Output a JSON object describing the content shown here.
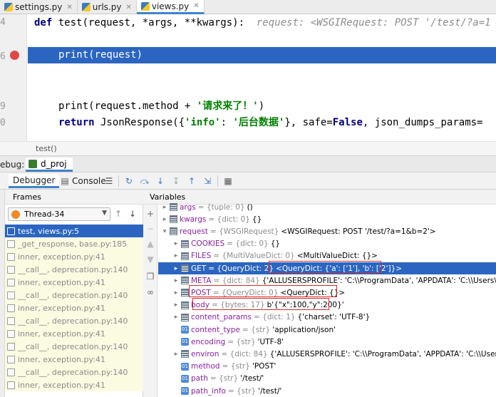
{
  "tabs": [
    {
      "label": "settings.py",
      "active": false
    },
    {
      "label": "urls.py",
      "active": false
    },
    {
      "label": "views.py",
      "active": true
    }
  ],
  "editor": {
    "line_numbers": [
      "4",
      "",
      "6",
      "",
      "",
      "9",
      "0",
      ""
    ],
    "def_line": {
      "kw": "def",
      "sig": " test(request, *args, **kwargs):",
      "hint": "  request: <WSGIRequest: POST '/test/?a=1"
    },
    "print_line": "print(request)",
    "method_line": {
      "code": "print(request.method + ",
      "str": "'请求来了！'",
      "end": ")"
    },
    "return_line": {
      "kw": "return",
      "pre": " JsonResponse({",
      "s1": "'info'",
      "mid": ": ",
      "s2": "'后台数据'",
      "post": "}, safe=",
      "kw2": "False",
      "tail": ", json_dumps_params="
    },
    "breadcrumb": "test()"
  },
  "debug": {
    "label": "ebug:",
    "project": "d_proj"
  },
  "toolbar": {
    "debugger_tab": "Debugger",
    "console_tab": "Console"
  },
  "frames": {
    "header": "Frames",
    "thread": "Thread-34",
    "items": [
      {
        "label": "test, views.py:5",
        "state": "active"
      },
      {
        "label": "_get_response, base.py:185",
        "state": "lib"
      },
      {
        "label": "inner, exception.py:41",
        "state": "lib"
      },
      {
        "label": "__call__, deprecation.py:140",
        "state": "lib"
      },
      {
        "label": "inner, exception.py:41",
        "state": "lib"
      },
      {
        "label": "__call__, deprecation.py:140",
        "state": "lib"
      },
      {
        "label": "inner, exception.py:41",
        "state": "lib"
      },
      {
        "label": "__call__, deprecation.py:140",
        "state": "lib"
      },
      {
        "label": "inner, exception.py:41",
        "state": "lib"
      },
      {
        "label": "__call__, deprecation.py:140",
        "state": "lib"
      },
      {
        "label": "inner, exception.py:41",
        "state": "lib"
      },
      {
        "label": "__call__, deprecation.py:140",
        "state": "lib"
      },
      {
        "label": "inner, exception.py:41",
        "state": "lib"
      }
    ]
  },
  "variables": {
    "header": "Variables",
    "rows": [
      {
        "indent": 0,
        "arrow": "▸",
        "icon": "obj",
        "name": "args",
        "type": "= {tuple: 0}",
        "value": "()"
      },
      {
        "indent": 0,
        "arrow": "▸",
        "icon": "obj",
        "name": "kwargs",
        "type": "= {dict: 0}",
        "value": "{}"
      },
      {
        "indent": 0,
        "arrow": "▾",
        "icon": "obj",
        "name": "request",
        "type": "= {WSGIRequest}",
        "value": "<WSGIRequest: POST '/test/?a=1&b=2'>"
      },
      {
        "indent": 1,
        "arrow": "▸",
        "icon": "obj",
        "name": "COOKIES",
        "type": "= {dict: 0}",
        "value": "{}"
      },
      {
        "indent": 1,
        "arrow": "▸",
        "icon": "obj",
        "name": "FILES",
        "type": "= {MultiValueDict: 0}",
        "value": "<MultiValueDict: {}>"
      },
      {
        "indent": 1,
        "arrow": "▸",
        "icon": "obj",
        "name": "GET",
        "type": "= {QueryDict: 2}",
        "value": "<QueryDict: {'a': ['1'], 'b': ['2']}>",
        "selected": true
      },
      {
        "indent": 1,
        "arrow": "▸",
        "icon": "obj",
        "name": "META",
        "type": "= {dict: 84}",
        "value": "{'ALLUSERSPROFILE': 'C:\\\\ProgramData', 'APPDATA': 'C:\\\\Users\\\\owe"
      },
      {
        "indent": 1,
        "arrow": "▸",
        "icon": "obj",
        "name": "POST",
        "type": "= {QueryDict: 0}",
        "value": "<QueryDict: {}>"
      },
      {
        "indent": 1,
        "arrow": "▸",
        "icon": "obj",
        "name": "body",
        "type": "= {bytes: 17}",
        "value": "b'{\"x\":100,\"y\":200}'"
      },
      {
        "indent": 1,
        "arrow": "▸",
        "icon": "obj",
        "name": "content_params",
        "type": "= {dict: 1}",
        "value": "{'charset': 'UTF-8'}"
      },
      {
        "indent": 1,
        "arrow": "",
        "icon": "prim",
        "name": "content_type",
        "type": "= {str}",
        "value": "'application/json'"
      },
      {
        "indent": 1,
        "arrow": "",
        "icon": "prim",
        "name": "encoding",
        "type": "= {str}",
        "value": "'UTF-8'"
      },
      {
        "indent": 1,
        "arrow": "▸",
        "icon": "obj",
        "name": "environ",
        "type": "= {dict: 84}",
        "value": "{'ALLUSERSPROFILE': 'C:\\\\ProgramData', 'APPDATA': 'C:\\\\Users\\\\owe"
      },
      {
        "indent": 1,
        "arrow": "",
        "icon": "prim",
        "name": "method",
        "type": "= {str}",
        "value": "'POST'"
      },
      {
        "indent": 1,
        "arrow": "",
        "icon": "prim",
        "name": "path",
        "type": "= {str}",
        "value": "'/test/'"
      },
      {
        "indent": 1,
        "arrow": "",
        "icon": "prim",
        "name": "path_info",
        "type": "= {str}",
        "value": "'/test/'"
      }
    ]
  },
  "colors": {
    "selection": "#2b65c1",
    "breakpoint": "#e04848",
    "annotation_box": "#d42b2b"
  }
}
